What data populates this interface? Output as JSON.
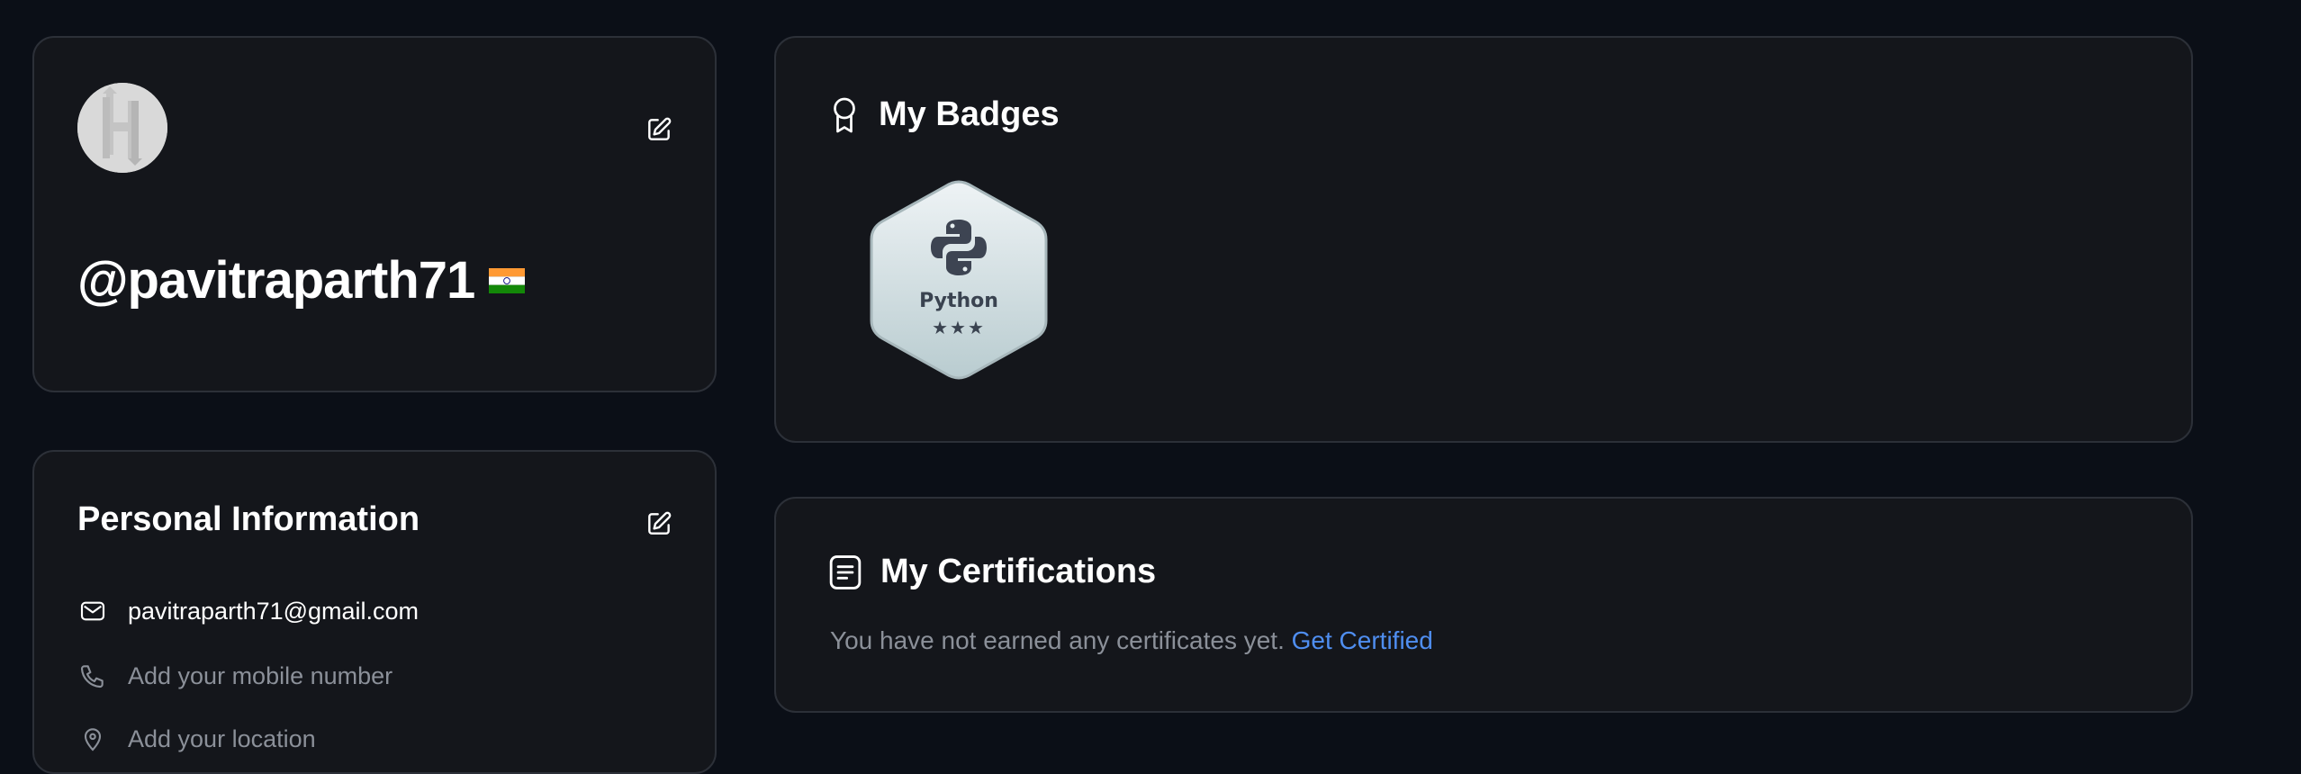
{
  "profile": {
    "avatar_icon": "hackerrank-logo-icon",
    "username": "@pavitraparth71",
    "flag_icon": "india-flag-icon",
    "edit_icon": "edit-icon"
  },
  "personal_info": {
    "title": "Personal Information",
    "email": "pavitraparth71@gmail.com",
    "mobile_placeholder": "Add your mobile number",
    "location_placeholder": "Add your location"
  },
  "badges": {
    "title": "My Badges",
    "icon": "award-ribbon-icon",
    "items": [
      {
        "label": "Python",
        "stars": "★★★",
        "icon": "python-logo-icon"
      }
    ]
  },
  "certifications": {
    "title": "My Certifications",
    "icon": "certificate-document-icon",
    "empty_text": "You have not earned any certificates yet.",
    "link_text": "Get Certified"
  },
  "colors": {
    "background": "#0b0f17",
    "card": "#14161b",
    "border": "#2c3038",
    "link": "#4f8ef0",
    "muted": "#8b9099"
  }
}
